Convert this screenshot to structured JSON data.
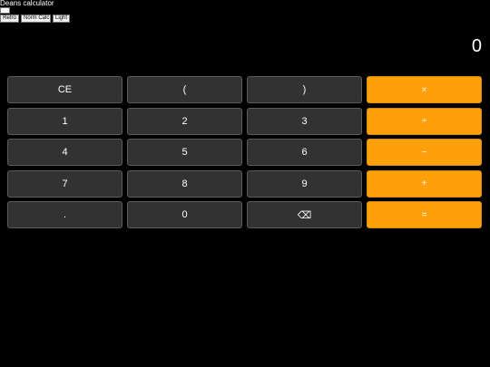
{
  "app": {
    "title": "Deans calculator"
  },
  "modes": [
    {
      "label": "Retro"
    },
    {
      "label": "Norm Calc"
    },
    {
      "label": "Light"
    }
  ],
  "display": {
    "value": "0"
  },
  "keys": {
    "clear": "CE",
    "paren_open": "(",
    "paren_close": ")",
    "multiply": "×",
    "one": "1",
    "two": "2",
    "three": "3",
    "divide": "÷",
    "four": "4",
    "five": "5",
    "six": "6",
    "minus": "−",
    "seven": "7",
    "eight": "8",
    "nine": "9",
    "plus": "+",
    "decimal": ".",
    "zero": "0",
    "backspace": "⌫",
    "equals": "="
  },
  "colors": {
    "background": "#000000",
    "key": "#323232",
    "operator": "#ff9f0a",
    "text": "#ffffff"
  }
}
